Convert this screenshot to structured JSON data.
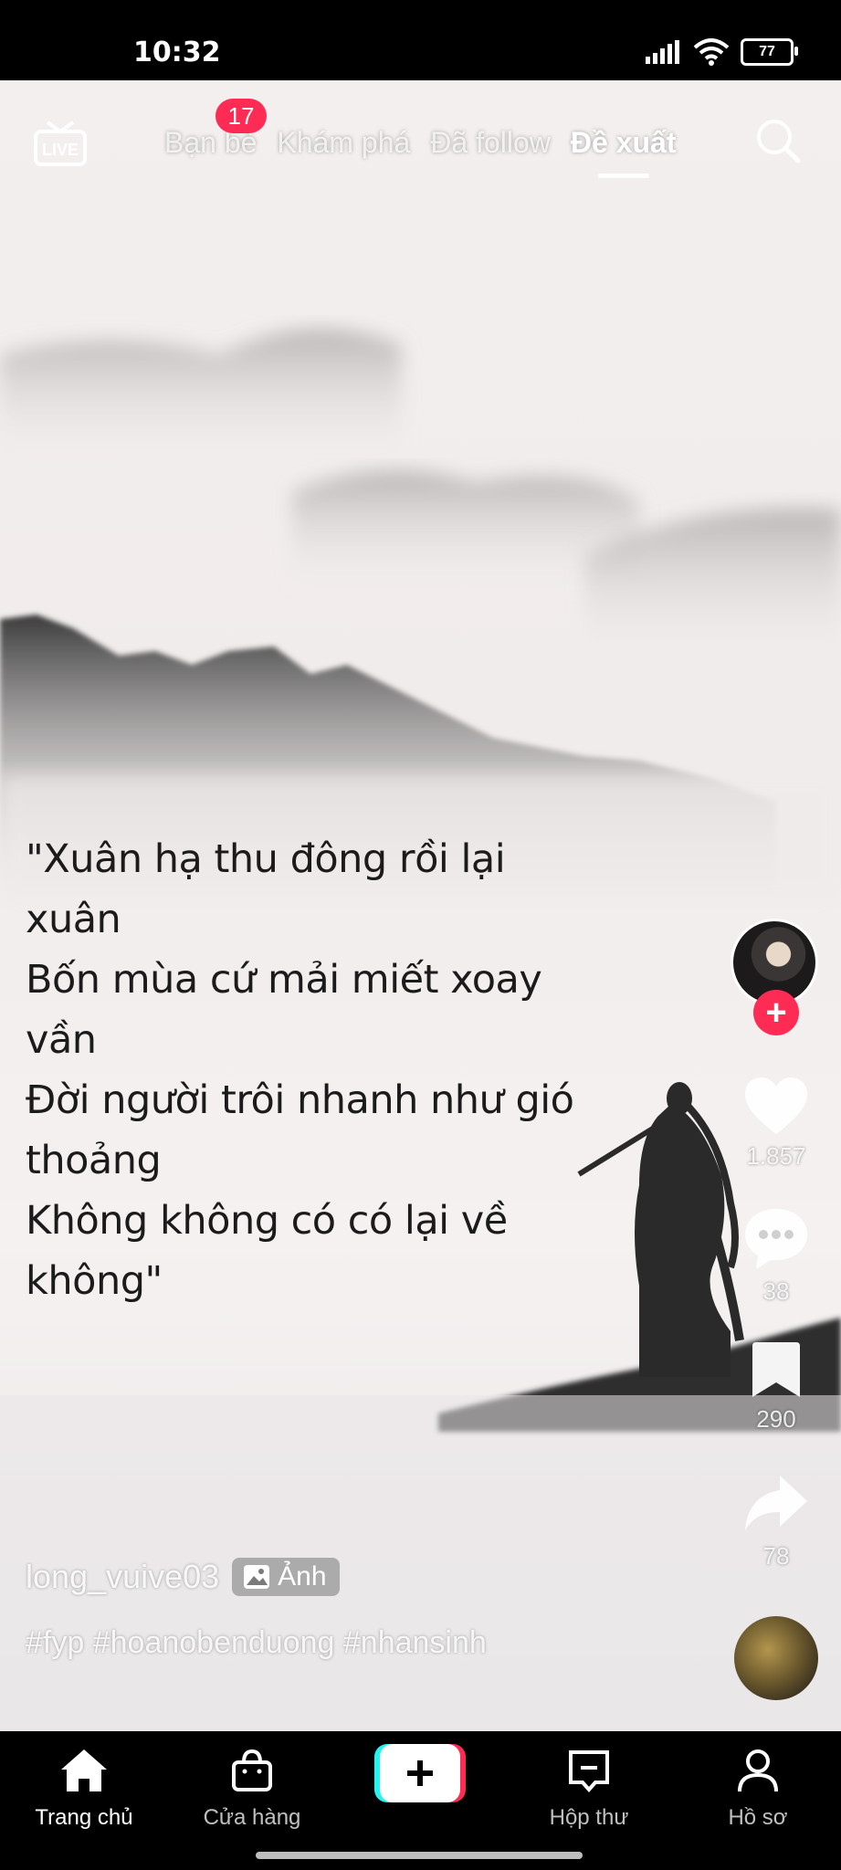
{
  "status": {
    "time": "10:32",
    "battery": "77"
  },
  "topnav": {
    "live_label": "LIVE",
    "tabs": [
      {
        "label": "Bạn bè",
        "badge": "17"
      },
      {
        "label": "Khám phá"
      },
      {
        "label": "Đã follow"
      },
      {
        "label": "Đề xuất",
        "active": true
      }
    ]
  },
  "post": {
    "caption": "\"Xuân hạ thu đông rồi lại\nxuân\nBốn mùa cứ mải miết xoay\nvần\nĐời người trôi nhanh như gió\nthoảng\nKhông không có có lại về\nkhông\"",
    "author": "long_vuive03",
    "photo_badge": "Ảnh",
    "hashtags": "#fyp #hoanobenduong #nhansinh"
  },
  "rail": {
    "likes": "1.857",
    "comments": "38",
    "saves": "290",
    "shares": "78"
  },
  "bottomnav": {
    "items": [
      "Trang chủ",
      "Cửa hàng",
      "Hộp thư",
      "Hồ sơ"
    ]
  },
  "colors": {
    "accent": "#fe2c55",
    "cyan": "#25f4ee"
  }
}
